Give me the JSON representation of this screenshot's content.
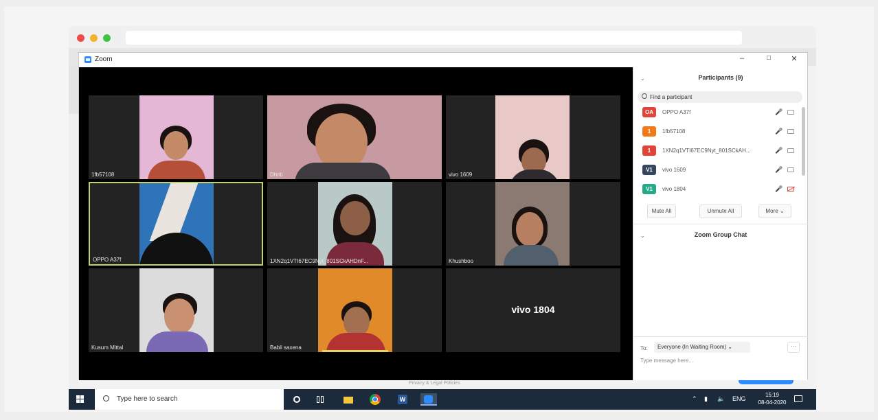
{
  "zoom": {
    "title": "Zoom",
    "window_controls": {
      "minimize": "–",
      "maximize": "□",
      "close": "✕"
    },
    "privacy_text": "Privacy & Legal Policies"
  },
  "tiles": [
    {
      "name": "1fb57108"
    },
    {
      "name": "Dhriti"
    },
    {
      "name": "vivo 1609"
    },
    {
      "name": "OPPO A37f",
      "active": true
    },
    {
      "name": "1XN2q1VTI67EC9Nyt_801SCkAHDnF..."
    },
    {
      "name": "Khushboo"
    },
    {
      "name": "Kusum Mittal"
    },
    {
      "name": "Babli saxena"
    },
    {
      "name": "vivo 1804",
      "video_off": true
    }
  ],
  "participants_panel": {
    "title": "Participants (9)",
    "search_placeholder": "Find a participant",
    "participants": [
      {
        "initials": "OA",
        "name": "OPPO A37f",
        "avatar_color": "#e0453a",
        "video": "on"
      },
      {
        "initials": "1",
        "name": "1fb57108",
        "avatar_color": "#f07a1a",
        "video": "on"
      },
      {
        "initials": "1",
        "name": "1XN2q1VTI67EC9Nyt_801SCkAH...",
        "avatar_color": "#e0453a",
        "video": "on"
      },
      {
        "initials": "V1",
        "name": "vivo 1609",
        "avatar_color": "#34475e",
        "video": "on"
      },
      {
        "initials": "V1",
        "name": "vivo 1804",
        "avatar_color": "#27a98a",
        "video": "off"
      }
    ],
    "buttons": {
      "mute_all": "Mute All",
      "unmute_all": "Unmute All",
      "more": "More ⌄"
    }
  },
  "chat_panel": {
    "title": "Zoom Group Chat",
    "to_label": "To:",
    "recipient": "Everyone (In Waiting Room) ⌄",
    "more": "···",
    "input_placeholder": "Type message here..."
  },
  "taskbar": {
    "search_placeholder": "Type here to search",
    "tray_language": "ENG",
    "time": "15:19",
    "date": "08-04-2020"
  },
  "colors": {
    "zoom_blue": "#2d8cff",
    "active_speaker": "#c6d36a",
    "taskbar": "#1c2b3c"
  }
}
